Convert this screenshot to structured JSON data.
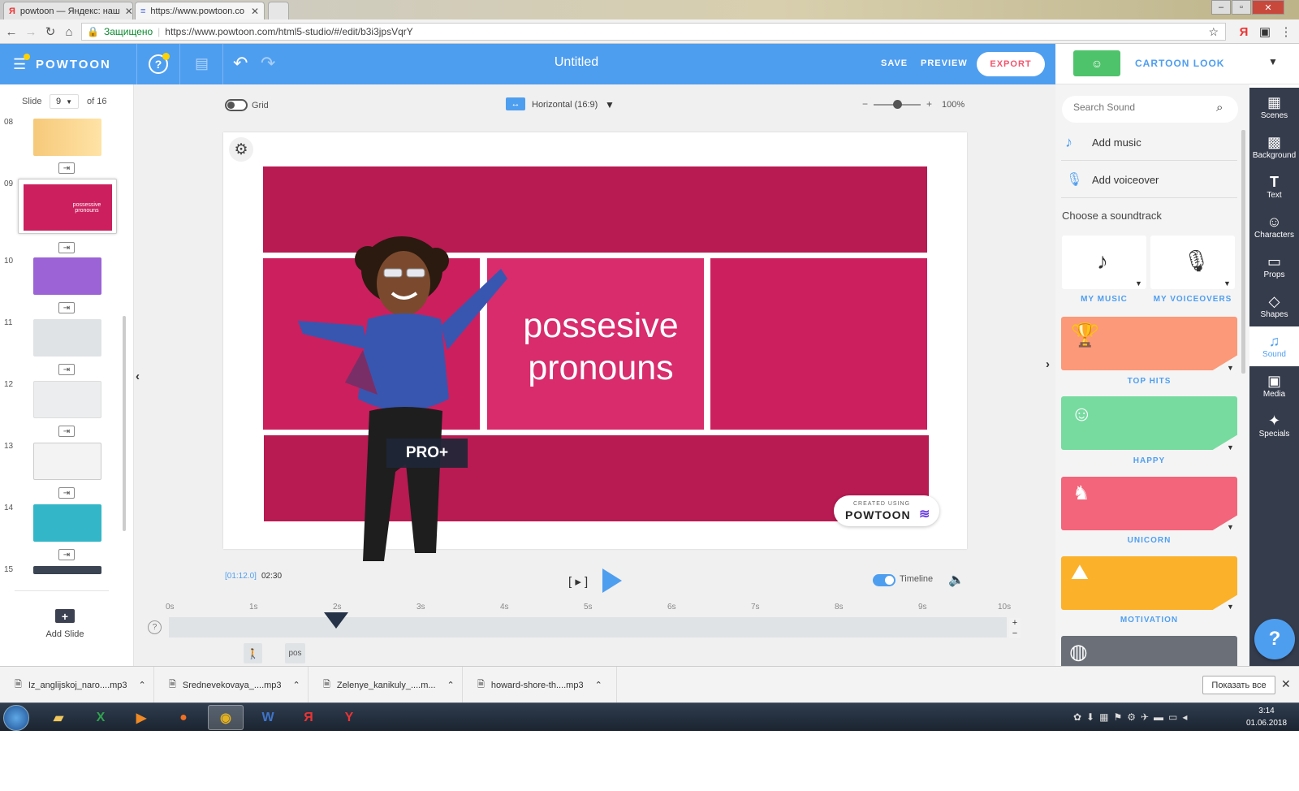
{
  "browser": {
    "tabs": [
      {
        "title": "powtoon — Яндекс: наш"
      },
      {
        "title": "https://www.powtoon.co"
      }
    ],
    "secure_label": "Защищено",
    "url": "https://www.powtoon.com/html5-studio/#/edit/b3i3jpsVqrY"
  },
  "topbar": {
    "logo": "POWTOON",
    "title": "Untitled",
    "save": "SAVE",
    "preview": "PREVIEW",
    "export": "EXPORT",
    "style_label": "CARTOON LOOK"
  },
  "left": {
    "slide_label": "Slide",
    "slide_current": "9",
    "slide_total": "of 16",
    "slides": [
      {
        "num": "08",
        "color": "#f6c97a"
      },
      {
        "num": "09",
        "color": "#cc1f5e"
      },
      {
        "num": "10",
        "color": "#9b63d6"
      },
      {
        "num": "11",
        "color": "#dfe3e6"
      },
      {
        "num": "12",
        "color": "#ecedee"
      },
      {
        "num": "13",
        "color": "#f3f3f3"
      },
      {
        "num": "14",
        "color": "#34b6c9"
      },
      {
        "num": "15",
        "color": "#3a4452"
      }
    ],
    "thumb09_text": "possessive pronouns",
    "add_slide": "Add Slide"
  },
  "toolbar": {
    "grid": "Grid",
    "ratio": "Horizontal (16:9)",
    "zoom_minus": "−",
    "zoom_plus": "+",
    "zoom": "100%"
  },
  "stage": {
    "text_line1": "possesive",
    "text_line2": "pronouns",
    "pro_badge": "PRO+",
    "watermark_small": "CREATED USING",
    "watermark": "POWTOON"
  },
  "playback": {
    "current_time": "[01:12.0]",
    "total_time": "02:30",
    "timeline_label": "Timeline",
    "ticks": [
      "0s",
      "1s",
      "2s",
      "3s",
      "4s",
      "5s",
      "6s",
      "7s",
      "8s",
      "9s",
      "10s"
    ],
    "track_item": "pos"
  },
  "sound": {
    "search_placeholder": "Search Sound",
    "add_music": "Add music",
    "add_voiceover": "Add voiceover",
    "choose": "Choose a soundtrack",
    "my_music": "MY MUSIC",
    "my_voiceovers": "MY VOICEOVERS",
    "cards": [
      {
        "label": "TOP HITS",
        "color": "#fb9979"
      },
      {
        "label": "HAPPY",
        "color": "#77dba0"
      },
      {
        "label": "UNICORN",
        "color": "#f2657a"
      },
      {
        "label": "MOTIVATION",
        "color": "#fbb12a"
      }
    ]
  },
  "rail": [
    "Scenes",
    "Background",
    "Text",
    "Characters",
    "Props",
    "Shapes",
    "Sound",
    "Media",
    "Specials"
  ],
  "downloads": {
    "files": [
      "Iz_anglijskoj_naro....mp3",
      "Srednevekovaya_....mp3",
      "Zelenye_kanikuly_....m...",
      "howard-shore-th....mp3"
    ],
    "show_all": "Показать все"
  },
  "taskbar": {
    "time": "3:14",
    "date": "01.06.2018"
  },
  "colors": {
    "accent": "#4e9ef0",
    "slide_pink": "#cc1f5e",
    "rail": "#353c4c"
  }
}
